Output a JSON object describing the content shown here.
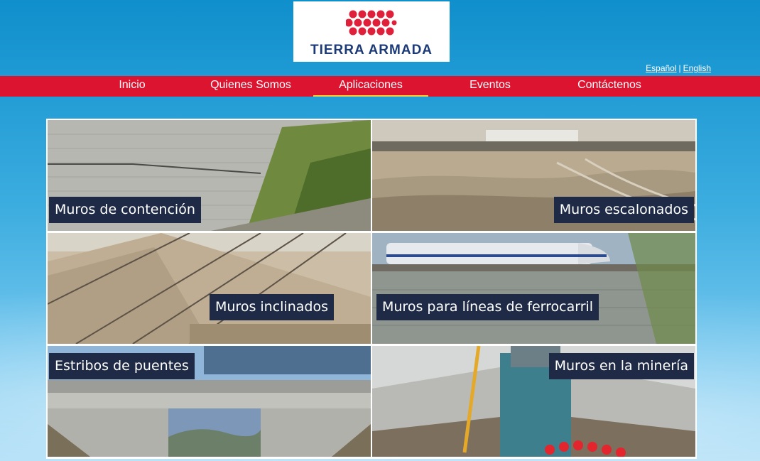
{
  "logo": {
    "text": "TIERRA ARMADA",
    "dot_color": "#e0203a",
    "text_color": "#1c3a78"
  },
  "languages": {
    "spanish": "Español",
    "separator": "|",
    "english": "English"
  },
  "nav": {
    "items": [
      {
        "label": "Inicio"
      },
      {
        "label": "Quienes Somos"
      },
      {
        "label": "Aplicaciones",
        "active": true
      },
      {
        "label": "Eventos"
      },
      {
        "label": "Contáctenos"
      }
    ],
    "bar_color": "#dd1430",
    "active_underline": "#f3d23a"
  },
  "applications": {
    "tiles": [
      {
        "caption": "Muros de contención"
      },
      {
        "caption": "Muros escalonados"
      },
      {
        "caption": "Muros inclinados"
      },
      {
        "caption": "Muros para líneas de ferrocarril"
      },
      {
        "caption": "Estribos de puentes"
      },
      {
        "caption": "Muros en la minería"
      }
    ]
  }
}
